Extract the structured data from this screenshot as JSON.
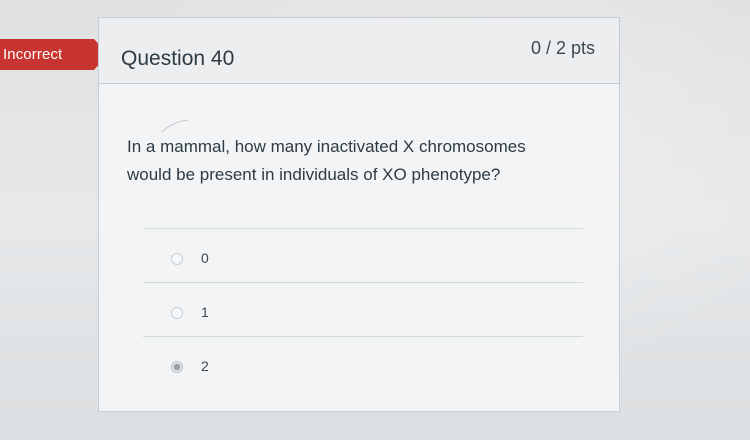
{
  "status": {
    "label": "Incorrect",
    "color": "#c8342f"
  },
  "question": {
    "title": "Question 40",
    "points": "0 / 2 pts",
    "text": "In a mammal, how many inactivated X chromosomes would be present in individuals of XO phenotype?"
  },
  "answers": [
    {
      "label": "0",
      "selected": false
    },
    {
      "label": "1",
      "selected": false
    },
    {
      "label": "2",
      "selected": true
    }
  ]
}
